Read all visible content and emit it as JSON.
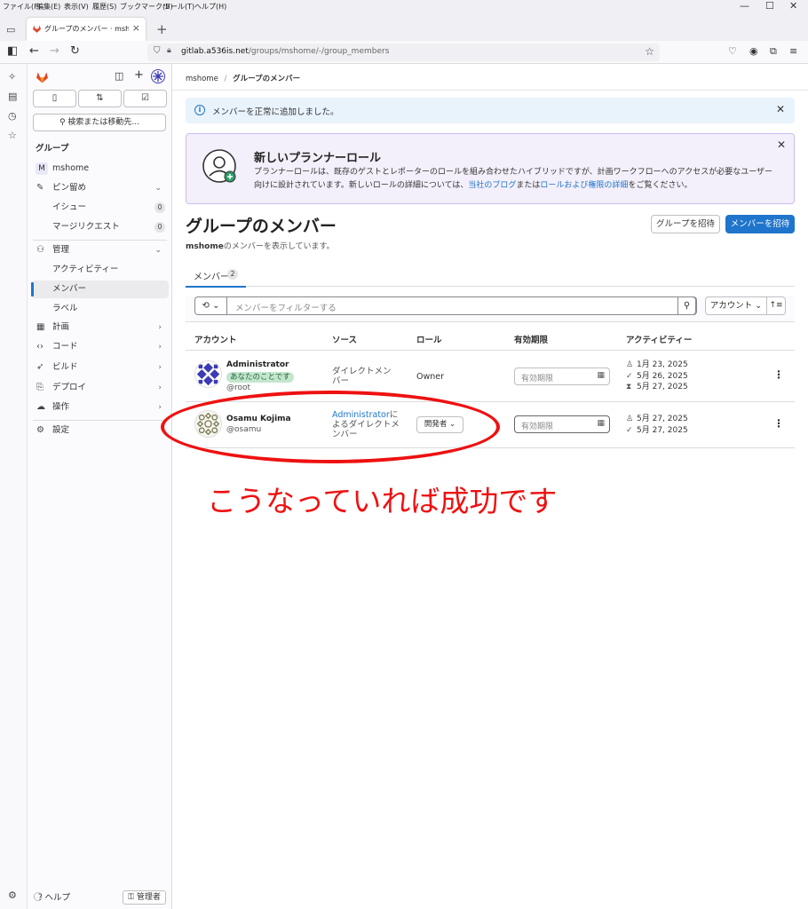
{
  "browser": {
    "menu": [
      "ファイル(F)",
      "編集(E)",
      "表示(V)",
      "履歴(S)",
      "ブックマーク(B)",
      "ツール(T)",
      "ヘルプ(H)"
    ],
    "tab_title": "グループのメンバー · mshome · GitL",
    "url_domain": "gitlab.a536is.net",
    "url_path": "/groups/mshome/-/group_members"
  },
  "sidebar": {
    "search": "検索または移動先...",
    "section_title": "グループ",
    "group_initial": "M",
    "group_name": "mshome",
    "pinned": "ピン留め",
    "issues": "イシュー",
    "issues_count": "0",
    "mrs": "マージリクエスト",
    "mrs_count": "0",
    "manage": "管理",
    "activity": "アクティビティー",
    "members": "メンバー",
    "labels": "ラベル",
    "plan": "計画",
    "code": "コード",
    "build": "ビルド",
    "deploy": "デプロイ",
    "operate": "操作",
    "settings": "設定",
    "help": "ヘルプ",
    "admin": "管理者"
  },
  "breadcrumb": {
    "group": "mshome",
    "sep": "/",
    "current": "グループのメンバー"
  },
  "alert": {
    "text": "メンバーを正常に追加しました。"
  },
  "promo": {
    "title": "新しいプランナーロール",
    "body_1": "プランナーロールは、既存のゲストとレポーターのロールを組み合わせたハイブリッドですが、計画ワークフローへのアクセスが必要なユーザー向けに設計されています。新しいロールの詳細については、",
    "link_1": "当社のブログ",
    "body_2": "または",
    "link_2": "ロールおよび権限の詳細",
    "body_3": "をご覧ください。"
  },
  "page": {
    "title": "グループのメンバー",
    "subtitle_group": "mshome",
    "subtitle_rest": "のメンバーを表示しています。",
    "invite_group": "グループを招待",
    "invite_member": "メンバーを招待",
    "tab_members": "メンバー",
    "tab_count": "2",
    "filter_placeholder": "メンバーをフィルターする",
    "sort_label": "アカウント"
  },
  "table": {
    "headers": [
      "アカウント",
      "ソース",
      "ロール",
      "有効期限",
      "アクティビティー"
    ],
    "rows": [
      {
        "name": "Administrator",
        "badge": "あなたのことです",
        "handle": "@root",
        "source": "ダイレクトメンバー",
        "role": "Owner",
        "expiry_placeholder": "有効期限",
        "activity": [
          "1月 23, 2025",
          "5月 26, 2025",
          "5月 27, 2025"
        ]
      },
      {
        "name": "Osamu Kojima",
        "handle": "@osamu",
        "source_link": "Administrator",
        "source_rest": "によるダイレクトメンバー",
        "role": "開発者",
        "expiry_placeholder": "有効期限",
        "activity": [
          "5月 27, 2025",
          "5月 27, 2025"
        ]
      }
    ]
  },
  "annotation": {
    "text": "こうなっていれば成功です",
    "color": "#ee1111"
  },
  "colors": {
    "accent": "#1f75cb",
    "promo_bg": "#f4f0fb",
    "alert_bg": "#e9f3fc"
  }
}
